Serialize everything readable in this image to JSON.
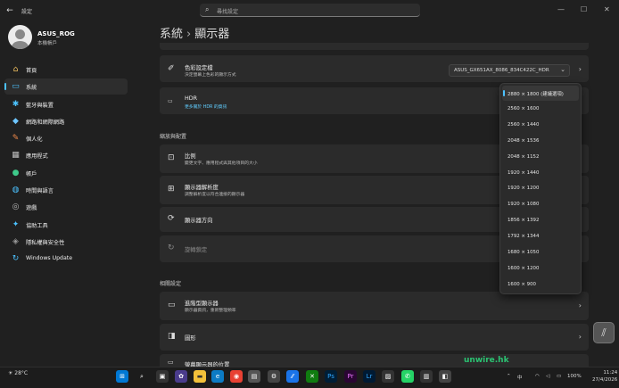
{
  "app": {
    "title": "設定",
    "search_placeholder": "尋找設定"
  },
  "user": {
    "name": "ASUS_ROG",
    "account": "本機帳戶"
  },
  "sidebar": {
    "items": [
      {
        "label": "首頁",
        "icon": "home-icon",
        "glyph": "⌂",
        "color": "#f0c060"
      },
      {
        "label": "系統",
        "icon": "system-icon",
        "glyph": "▭",
        "color": "#4cc2ff",
        "selected": true
      },
      {
        "label": "藍牙與裝置",
        "icon": "bluetooth-icon",
        "glyph": "✱",
        "color": "#4cc2ff"
      },
      {
        "label": "網路和網際網路",
        "icon": "network-icon",
        "glyph": "◆",
        "color": "#6ec6ff"
      },
      {
        "label": "個人化",
        "icon": "brush-icon",
        "glyph": "✎",
        "color": "#f08a4b"
      },
      {
        "label": "應用程式",
        "icon": "apps-icon",
        "glyph": "▦",
        "color": "#c0c0c0"
      },
      {
        "label": "帳戶",
        "icon": "account-icon",
        "glyph": "●",
        "color": "#3ec98a"
      },
      {
        "label": "時間與語言",
        "icon": "time-language-icon",
        "glyph": "◍",
        "color": "#4cc2ff"
      },
      {
        "label": "遊戲",
        "icon": "gaming-icon",
        "glyph": "◎",
        "color": "#bbbbbb"
      },
      {
        "label": "協助工具",
        "icon": "accessibility-icon",
        "glyph": "✦",
        "color": "#4cc2ff"
      },
      {
        "label": "隱私權與安全性",
        "icon": "shield-icon",
        "glyph": "◈",
        "color": "#999999"
      },
      {
        "label": "Windows Update",
        "icon": "update-icon",
        "glyph": "↻",
        "color": "#4cc2ff"
      }
    ]
  },
  "breadcrumb": {
    "parent": "系統",
    "separator": "›",
    "current": "顯示器"
  },
  "cards": {
    "color_profile": {
      "title": "色彩設定檔",
      "subtitle": "決定螢幕上色彩的顯示方式",
      "value": "ASUS_GX651AX_8086_834C422C_HDR",
      "icon": "eyedropper-icon"
    },
    "hdr": {
      "title": "HDR",
      "subtitle": "更多關於 HDR 的資訊",
      "icon": "hdr-icon"
    },
    "scale": {
      "title": "比例",
      "subtitle": "變更文字、應用程式與其他項目的大小",
      "icon": "scale-icon"
    },
    "resolution": {
      "title": "顯示器解析度",
      "subtitle": "調整解析度以符合連接的顯示器",
      "icon": "resolution-icon"
    },
    "orientation": {
      "title": "顯示器方向",
      "icon": "orientation-icon"
    },
    "rotation_lock": {
      "title": "旋轉鎖定",
      "icon": "rotation-lock-icon"
    },
    "advanced_display": {
      "title": "進階型顯示器",
      "subtitle": "顯示器資訊，重新整理頻率",
      "icon": "monitor-icon"
    },
    "graphics": {
      "title": "圖形",
      "icon": "graphics-icon"
    },
    "multi_display": {
      "title": "螢幕顯示器的位置",
      "icon": "multi-display-icon"
    }
  },
  "sections": {
    "scale_layout": "縮放與配置",
    "related": "相關設定"
  },
  "resolution_options": [
    "2880 × 1800 (建議選項)",
    "2560 × 1600",
    "2560 × 1440",
    "2048 × 1536",
    "2048 × 1152",
    "1920 × 1440",
    "1920 × 1200",
    "1920 × 1080",
    "1856 × 1392",
    "1792 × 1344",
    "1680 × 1050",
    "1600 × 1200",
    "1600 × 900"
  ],
  "selected_resolution_index": 0,
  "taskbar": {
    "weather": "28°C",
    "language": "中",
    "battery": "100%",
    "time": "11:24",
    "date": "27/4/2026",
    "watermark": "unwire.hk"
  }
}
